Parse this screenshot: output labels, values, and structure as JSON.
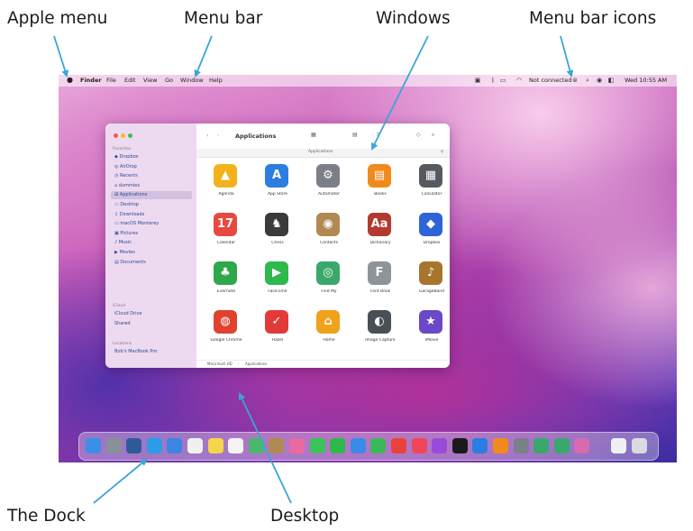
{
  "callouts": {
    "apple_menu": "Apple menu",
    "menu_bar": "Menu bar",
    "windows": "Windows",
    "menu_bar_icons": "Menu bar icons",
    "the_dock": "The Dock",
    "desktop": "Desktop"
  },
  "colors": {
    "callout_line": "#3aa6d6",
    "accent": "#2a7ae2"
  },
  "menubar": {
    "apple": "",
    "items": [
      "Finder",
      "File",
      "Edit",
      "View",
      "Go",
      "Window",
      "Help"
    ],
    "status_text": "Not connected",
    "clock": "Wed 10:55 AM",
    "status_icons": [
      "extensions-icon",
      "bluetooth-icon",
      "wifi-icon",
      "control-center-icon",
      "search-icon",
      "siri-icon",
      "notification-icon"
    ]
  },
  "finder": {
    "title": "Applications",
    "path_label": "Applications",
    "sidebar": {
      "favorites_header": "Favorites",
      "favorites": [
        "Dropbox",
        "AirDrop",
        "Recents",
        "dummies",
        "Applications",
        "Desktop",
        "Downloads",
        "macOS Monterey",
        "Pictures",
        "Music",
        "Movies",
        "Documents"
      ],
      "selected_index": 4,
      "icloud_header": "iCloud",
      "icloud": [
        "iCloud Drive",
        "Shared"
      ],
      "locations_header": "Locations",
      "locations": [
        "Bob's MacBook Pro"
      ]
    },
    "apps": [
      {
        "name": "Agenda",
        "glyph": "▲",
        "color": "#f2b21c"
      },
      {
        "name": "App Store",
        "glyph": "A",
        "color": "#2b7de0"
      },
      {
        "name": "Automator",
        "glyph": "⚙",
        "color": "#7a7f88"
      },
      {
        "name": "Books",
        "glyph": "▤",
        "color": "#f08a1c"
      },
      {
        "name": "Calculator",
        "glyph": "▦",
        "color": "#555a60"
      },
      {
        "name": "Calendar",
        "glyph": "17",
        "color": "#e8493f"
      },
      {
        "name": "Chess",
        "glyph": "♞",
        "color": "#3a3a3a"
      },
      {
        "name": "Contacts",
        "glyph": "◉",
        "color": "#b08a52"
      },
      {
        "name": "Dictionary",
        "glyph": "Aa",
        "color": "#b33a2e"
      },
      {
        "name": "Dropbox",
        "glyph": "◆",
        "color": "#2d64d8"
      },
      {
        "name": "Evernote",
        "glyph": "♣",
        "color": "#2ea84a"
      },
      {
        "name": "FaceTime",
        "glyph": "▶",
        "color": "#2fb84c"
      },
      {
        "name": "Find My",
        "glyph": "◎",
        "color": "#3aa86b"
      },
      {
        "name": "Font Book",
        "glyph": "F",
        "color": "#8f9499"
      },
      {
        "name": "GarageBand",
        "glyph": "♪",
        "color": "#a8752e"
      },
      {
        "name": "Google Chrome",
        "glyph": "◍",
        "color": "#e0422f"
      },
      {
        "name": "Hazel",
        "glyph": "✓",
        "color": "#e23a3a"
      },
      {
        "name": "Home",
        "glyph": "⌂",
        "color": "#f0a21c"
      },
      {
        "name": "Image Capture",
        "glyph": "◐",
        "color": "#4a4f56"
      },
      {
        "name": "iMovie",
        "glyph": "★",
        "color": "#6a48c8"
      }
    ],
    "status_path": [
      "Macintosh HD",
      "Applications"
    ]
  },
  "dock": {
    "icons": [
      {
        "name": "finder-icon",
        "color": "#3b8fe8"
      },
      {
        "name": "launchpad-icon",
        "color": "#8a8f98"
      },
      {
        "name": "mission-control-icon",
        "color": "#2f5a9a"
      },
      {
        "name": "safari-icon",
        "color": "#2b9de8"
      },
      {
        "name": "mail-icon",
        "color": "#3a86e0"
      },
      {
        "name": "calendar-icon",
        "color": "#f0f0f0"
      },
      {
        "name": "notes-icon",
        "color": "#f5d64a"
      },
      {
        "name": "reminders-icon",
        "color": "#f3f3f3"
      },
      {
        "name": "maps-icon",
        "color": "#4ab86a"
      },
      {
        "name": "contacts-icon",
        "color": "#b08a52"
      },
      {
        "name": "photos-icon",
        "color": "#e86aa0"
      },
      {
        "name": "messages-icon",
        "color": "#3ac45a"
      },
      {
        "name": "facetime-icon",
        "color": "#2fb84c"
      },
      {
        "name": "keynote-icon",
        "color": "#3a8ae8"
      },
      {
        "name": "numbers-icon",
        "color": "#3ab85a"
      },
      {
        "name": "news-icon",
        "color": "#e8423a"
      },
      {
        "name": "music-icon",
        "color": "#f0465a"
      },
      {
        "name": "podcasts-icon",
        "color": "#9a4ad8"
      },
      {
        "name": "tv-icon",
        "color": "#1a1a1a"
      },
      {
        "name": "app-store-icon",
        "color": "#2b7de0"
      },
      {
        "name": "books-icon",
        "color": "#f08a1c"
      },
      {
        "name": "system-preferences-icon",
        "color": "#7a7f88"
      },
      {
        "name": "chrome-icon",
        "color": "#3aa86b"
      },
      {
        "name": "find-my-icon",
        "color": "#3aa86b"
      },
      {
        "name": "screen-time-icon",
        "color": "#d86ab0"
      },
      {
        "name": "downloads-folder-icon",
        "color": "#eef0f4"
      },
      {
        "name": "trash-icon",
        "color": "#d8dbe0"
      }
    ]
  }
}
